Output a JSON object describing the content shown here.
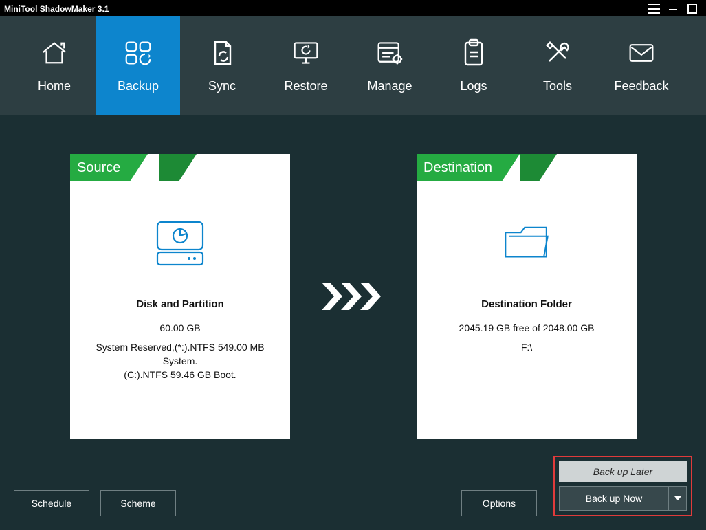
{
  "app": {
    "title": "MiniTool ShadowMaker 3.1"
  },
  "tabs": {
    "home": "Home",
    "backup": "Backup",
    "sync": "Sync",
    "restore": "Restore",
    "manage": "Manage",
    "logs": "Logs",
    "tools": "Tools",
    "feedback": "Feedback"
  },
  "source": {
    "label": "Source",
    "heading": "Disk and Partition",
    "size": "60.00 GB",
    "details_line1": "System Reserved,(*:).NTFS 549.00 MB System.",
    "details_line2": "(C:).NTFS 59.46 GB Boot."
  },
  "destination": {
    "label": "Destination",
    "heading": "Destination Folder",
    "free": "2045.19 GB free of 2048.00 GB",
    "path": "F:\\"
  },
  "buttons": {
    "schedule": "Schedule",
    "scheme": "Scheme",
    "options": "Options",
    "backup_later": "Back up Later",
    "backup_now": "Back up Now"
  }
}
